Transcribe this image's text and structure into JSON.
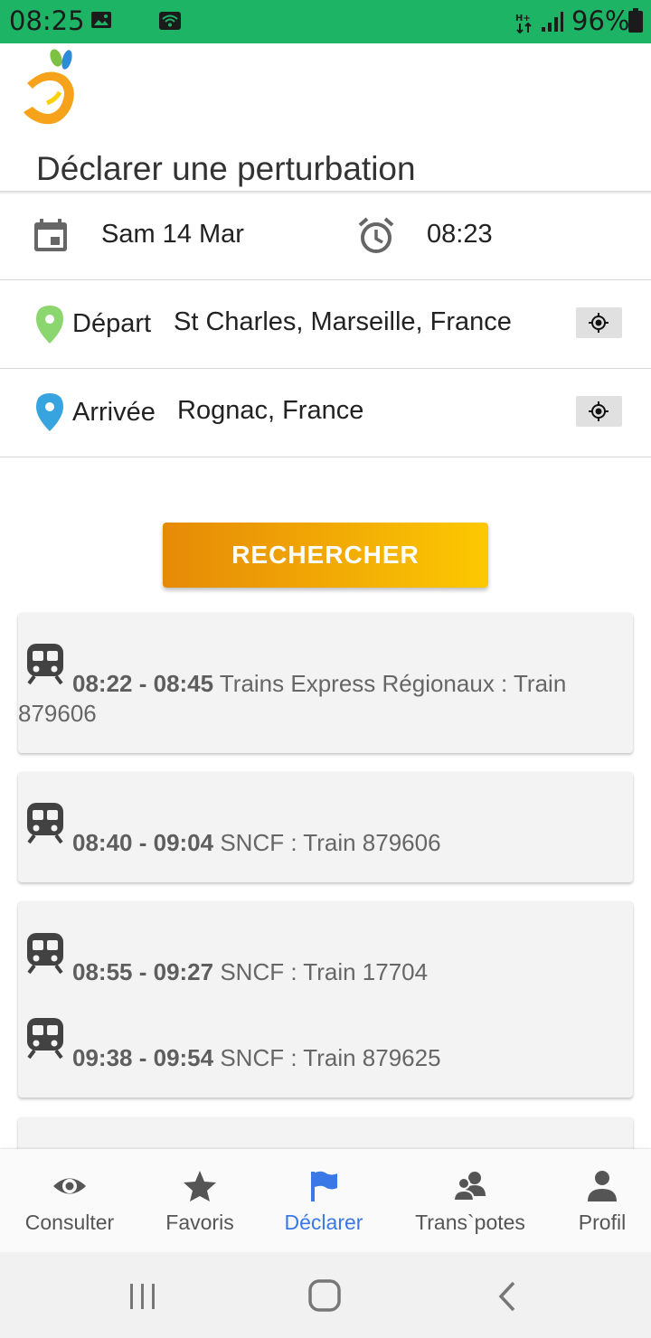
{
  "status_bar": {
    "time": "08:25",
    "battery_percent": "96%",
    "background_color": "#1db565"
  },
  "header": {
    "title": "Déclarer une perturbation"
  },
  "form": {
    "date": "Sam 14 Mar",
    "time": "08:23",
    "depart": {
      "label": "Départ",
      "value": "St Charles, Marseille, France"
    },
    "arrivee": {
      "label": "Arrivée",
      "value": "Rognac, France"
    },
    "search_label": "RECHERCHER"
  },
  "results": [
    {
      "times": "08:22 - 08:45",
      "description": " Trains Express Régionaux : Train 879606"
    },
    {
      "times": "08:40 - 09:04",
      "description": " SNCF : Train 879606"
    },
    {
      "times": "08:55 - 09:27",
      "description": " SNCF : Train 17704"
    },
    {
      "times": "09:38 - 09:54",
      "description": " SNCF : Train 879625"
    }
  ],
  "bottom_nav": {
    "consulter": "Consulter",
    "favoris": "Favoris",
    "declarer": "Déclarer",
    "transpotes": "Trans`potes",
    "profil": "Profil",
    "active": "declarer",
    "active_color": "#3b78e7"
  },
  "icons": {
    "status": [
      "image-icon",
      "wifi-icon",
      "mobile-data-icon",
      "signal-icon",
      "battery-icon"
    ],
    "form": [
      "calendar-icon",
      "alarm-icon",
      "location-pin-icon",
      "my-location-icon"
    ],
    "results": [
      "train-icon"
    ],
    "nav": [
      "eye-icon",
      "star-icon",
      "flag-icon",
      "group-icon",
      "person-icon"
    ]
  }
}
